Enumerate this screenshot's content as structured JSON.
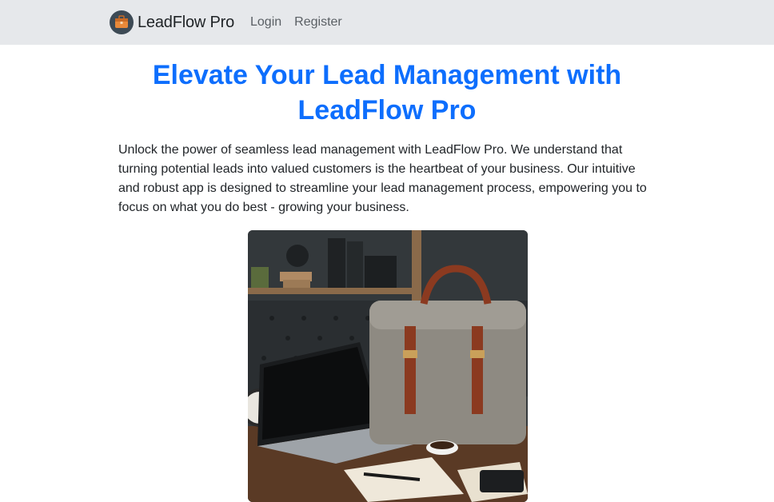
{
  "navbar": {
    "brand": "LeadFlow Pro",
    "links": [
      {
        "label": "Login"
      },
      {
        "label": "Register"
      }
    ]
  },
  "hero": {
    "title": "Elevate Your Lead Management with LeadFlow Pro",
    "description": "Unlock the power of seamless lead management with LeadFlow Pro. We understand that turning potential leads into valued customers is the heartbeat of your business. Our intuitive and robust app is designed to streamline your lead management process, empowering you to focus on what you do best - growing your business.",
    "image_icon": "briefcase-laptop-desk-photo"
  },
  "colors": {
    "accent": "#0d6efd",
    "navbar_bg": "#e6e8eb",
    "text": "#212529"
  }
}
